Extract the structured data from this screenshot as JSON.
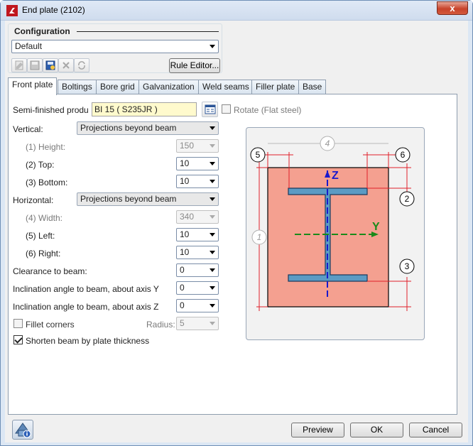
{
  "window": {
    "title": "End plate (2102)",
    "close_glyph": "x"
  },
  "configuration": {
    "title": "Configuration",
    "selected": "Default",
    "rule_editor_label": "Rule Editor...",
    "toolbar_icons": [
      "edit-icon",
      "save-icon",
      "save-as-icon",
      "delete-icon",
      "refresh-icon"
    ]
  },
  "tabs": [
    {
      "label": "Front plate",
      "active": true
    },
    {
      "label": "Boltings"
    },
    {
      "label": "Bore grid"
    },
    {
      "label": "Galvanization"
    },
    {
      "label": "Weld seams"
    },
    {
      "label": "Filler plate"
    },
    {
      "label": "Base"
    }
  ],
  "form": {
    "semi_finished_label": "Semi-finished produ",
    "semi_finished_value": "BI 15  ( S235JR )",
    "rotate_label": "Rotate (Flat steel)",
    "vertical_label": "Vertical:",
    "vertical_value": "Projections beyond beam",
    "height_label": "(1) Height:",
    "height_value": "150",
    "top_label": "(2) Top:",
    "top_value": "10",
    "bottom_label": "(3) Bottom:",
    "bottom_value": "10",
    "horizontal_label": "Horizontal:",
    "horizontal_value": "Projections beyond beam",
    "width_label": "(4) Width:",
    "width_value": "340",
    "left_label": "(5) Left:",
    "left_value": "10",
    "right_label": "(6) Right:",
    "right_value": "10",
    "clearance_label": "Clearance to beam:",
    "clearance_value": "0",
    "incl_y_label": "Inclination angle to beam, about axis Y",
    "incl_y_value": "0",
    "incl_z_label": "Inclination angle to beam, about axis Z",
    "incl_z_value": "0",
    "fillet_label": "Fillet corners",
    "radius_label": "Radius:",
    "radius_value": "5",
    "shorten_label": "Shorten beam by plate thickness",
    "shorten_checked": true,
    "fillet_checked": false,
    "rotate_checked": false
  },
  "diagram": {
    "marker_1": "1",
    "marker_2": "2",
    "marker_3": "3",
    "marker_4": "4",
    "marker_5": "5",
    "marker_6": "6",
    "axis_z": "Z",
    "axis_y": "Y",
    "colors": {
      "plate": "#f4a090",
      "beam": "#5b9bc4",
      "dim": "#e0202a",
      "z_axis": "#1a1acc",
      "y_axis": "#1a8a1a"
    }
  },
  "buttons": {
    "preview": "Preview",
    "ok": "OK",
    "cancel": "Cancel"
  }
}
